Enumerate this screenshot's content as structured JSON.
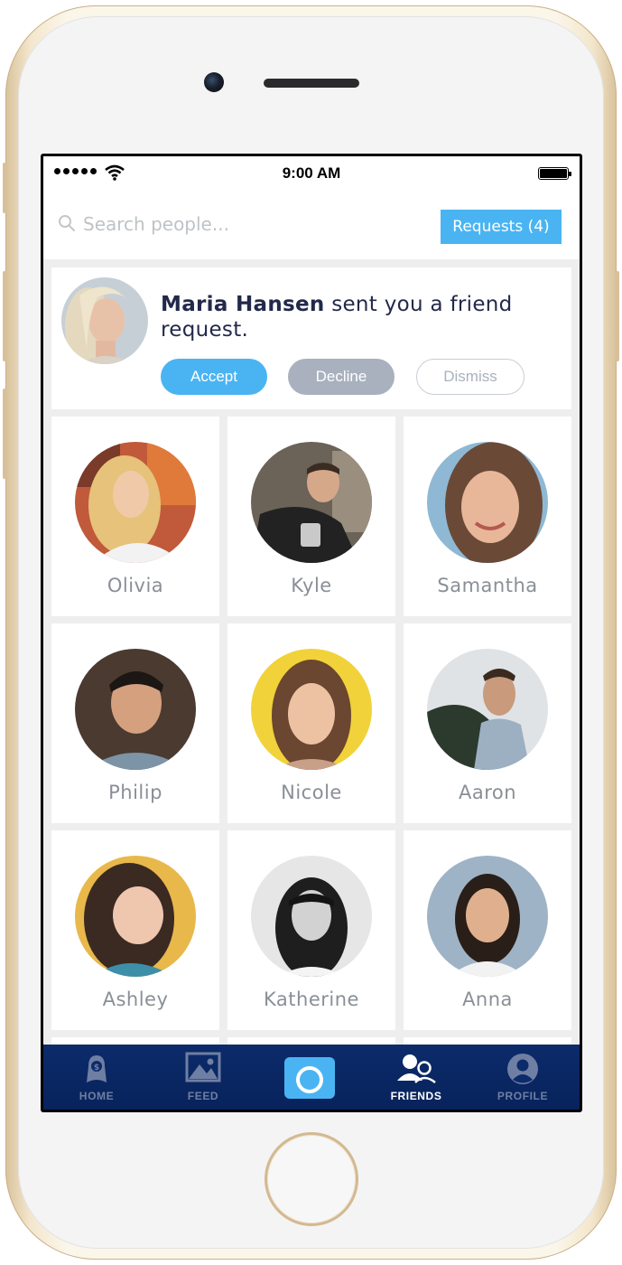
{
  "status_bar": {
    "time": "9:00 AM"
  },
  "search": {
    "placeholder": "Search people..."
  },
  "requests_button": {
    "label": "Requests (4)"
  },
  "friend_request": {
    "sender": "Maria Hansen",
    "message": " sent you a friend request.",
    "accept_label": "Accept",
    "decline_label": "Decline",
    "dismiss_label": "Dismiss"
  },
  "friends": [
    {
      "name": "Olivia"
    },
    {
      "name": "Kyle"
    },
    {
      "name": "Samantha"
    },
    {
      "name": "Philip"
    },
    {
      "name": "Nicole"
    },
    {
      "name": "Aaron"
    },
    {
      "name": "Ashley"
    },
    {
      "name": "Katherine"
    },
    {
      "name": "Anna"
    }
  ],
  "tabs": [
    {
      "label": "HOME",
      "icon": "piggy-bank-icon"
    },
    {
      "label": "FEED",
      "icon": "image-icon"
    },
    {
      "label": "FRIENDS",
      "icon": "friends-icon",
      "active": true
    },
    {
      "label": "PROFILE",
      "icon": "user-circle-icon"
    }
  ],
  "colors": {
    "accent": "#4ab4f2",
    "decline": "#a9b1bf",
    "tab_bar": "#0c2b6a",
    "text_dark": "#22294a",
    "text_muted": "#8a8f96"
  }
}
